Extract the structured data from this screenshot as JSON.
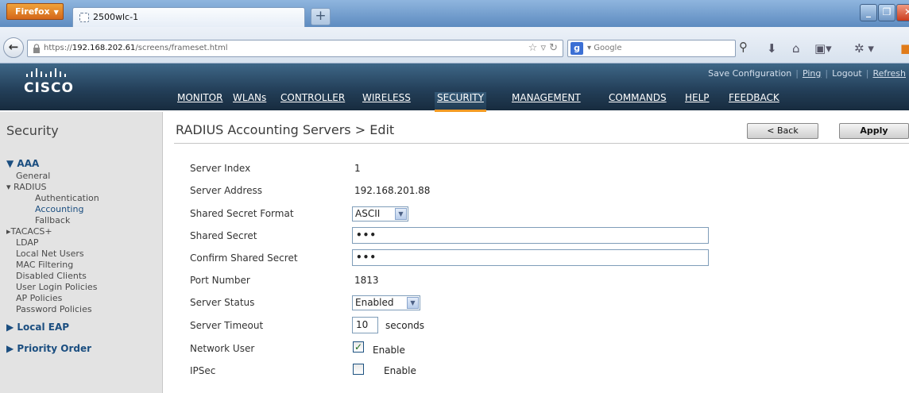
{
  "browser": {
    "menu_label": "Firefox",
    "tab_title": "2500wlc-1",
    "url_prefix": "https://",
    "url_host": "192.168.202.61",
    "url_path": "/screens/frameset.html",
    "search_placeholder": "Google"
  },
  "header": {
    "logo_text": "CISCO",
    "top_links": [
      "Save Configuration",
      "Ping",
      "Logout",
      "Refresh"
    ],
    "menu": [
      "MONITOR",
      "WLANs",
      "CONTROLLER",
      "WIRELESS",
      "SECURITY",
      "MANAGEMENT",
      "COMMANDS",
      "HELP",
      "FEEDBACK"
    ],
    "active_menu": "SECURITY",
    "accent_color": "#f29a23"
  },
  "sidebar": {
    "title": "Security",
    "items": [
      {
        "label": "AAA"
      },
      {
        "label": "General"
      },
      {
        "label": "RADIUS"
      },
      {
        "label": "Authentication"
      },
      {
        "label": "Accounting"
      },
      {
        "label": "Fallback"
      },
      {
        "label": "TACACS+"
      },
      {
        "label": "LDAP"
      },
      {
        "label": "Local Net Users"
      },
      {
        "label": "MAC Filtering"
      },
      {
        "label": "Disabled Clients"
      },
      {
        "label": "User Login Policies"
      },
      {
        "label": "AP Policies"
      },
      {
        "label": "Password Policies"
      },
      {
        "label": "Local EAP"
      },
      {
        "label": "Priority Order"
      }
    ]
  },
  "page": {
    "title": "RADIUS Accounting Servers > Edit",
    "back_label": "< Back",
    "apply_label": "Apply"
  },
  "form": {
    "server_index_label": "Server Index",
    "server_index": "1",
    "server_address_label": "Server Address",
    "server_address": "192.168.201.88",
    "secret_format_label": "Shared Secret Format",
    "secret_format": "ASCII",
    "shared_secret_label": "Shared Secret",
    "shared_secret": "•••",
    "confirm_secret_label": "Confirm Shared Secret",
    "confirm_secret": "•••",
    "port_label": "Port Number",
    "port": "1813",
    "status_label": "Server Status",
    "status": "Enabled",
    "timeout_label": "Server Timeout",
    "timeout": "10",
    "timeout_unit": "seconds",
    "network_user_label": "Network User",
    "network_user_checked": true,
    "network_user_enable": "Enable",
    "ipsec_label": "IPSec",
    "ipsec_checked": false,
    "ipsec_enable": "Enable"
  }
}
